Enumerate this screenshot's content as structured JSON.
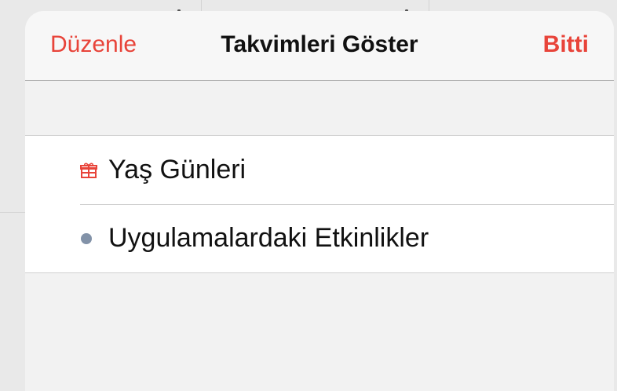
{
  "navbar": {
    "edit_label": "Düzenle",
    "title": "Takvimleri Göster",
    "done_label": "Bitti"
  },
  "calendars": [
    {
      "label": "Yaş Günleri",
      "icon": "gift-icon",
      "color": "#e8443a"
    },
    {
      "label": "Uygulamalardaki Etkinlikler",
      "icon": "dot-icon",
      "color": "#8292a8"
    }
  ],
  "colors": {
    "accent": "#e8443a"
  }
}
